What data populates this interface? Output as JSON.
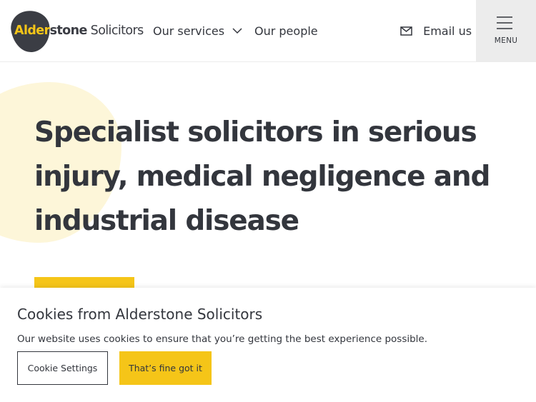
{
  "header": {
    "logo": {
      "part1": "Alder",
      "part2": "stone",
      "part3": " Solicitors"
    },
    "nav": [
      {
        "label": "Our services",
        "icon": "chevron-down-icon"
      },
      {
        "label": "Our people"
      }
    ],
    "email": {
      "label": "Email us",
      "icon": "envelope-icon"
    },
    "menu": {
      "label": "MENU",
      "icon": "hamburger-icon"
    }
  },
  "hero": {
    "title": "Specialist solicitors in serious injury, medical negligence and industrial disease"
  },
  "cookie_banner": {
    "title": "Cookies from Alderstone Solicitors",
    "text": "Our website uses cookies to ensure that you’re getting the best experience possible.",
    "settings_label": "Cookie Settings",
    "accept_label": "That’s fine got it"
  },
  "colors": {
    "brand_yellow": "#f5c518",
    "brand_dark": "#3b3d44",
    "hero_blob": "#fdf6d9",
    "menu_bg": "#ececec"
  }
}
